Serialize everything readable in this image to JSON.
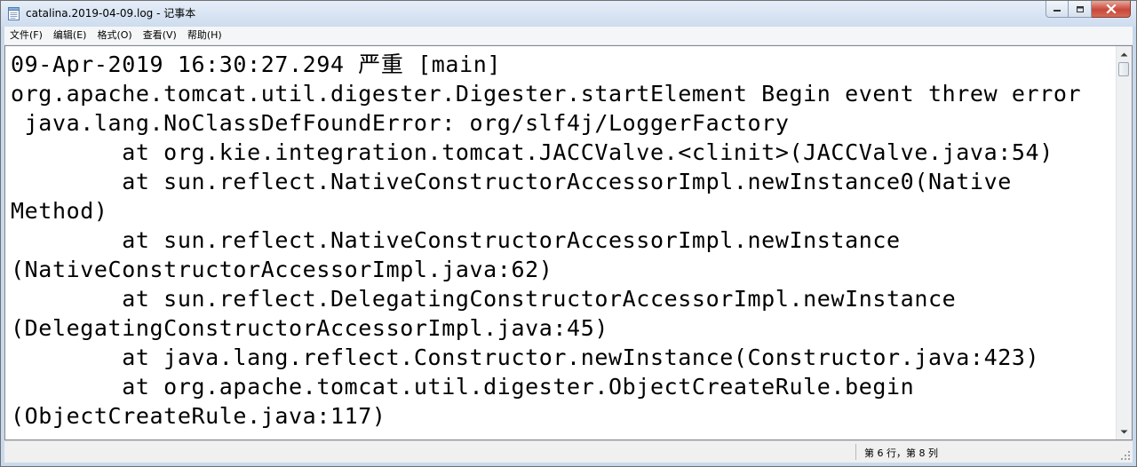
{
  "window": {
    "title": "catalina.2019-04-09.log - 记事本"
  },
  "menu": [
    {
      "label": "文件(F)"
    },
    {
      "label": "编辑(E)"
    },
    {
      "label": "格式(O)"
    },
    {
      "label": "查看(V)"
    },
    {
      "label": "帮助(H)"
    }
  ],
  "editor": {
    "lines": [
      "09-Apr-2019 16:30:27.294 严重 [main]",
      "org.apache.tomcat.util.digester.Digester.startElement Begin event threw error",
      " java.lang.NoClassDefFoundError: org/slf4j/LoggerFactory",
      "        at org.kie.integration.tomcat.JACCValve.<clinit>(JACCValve.java:54)",
      "        at sun.reflect.NativeConstructorAccessorImpl.newInstance0(Native",
      "Method)",
      "        at sun.reflect.NativeConstructorAccessorImpl.newInstance",
      "(NativeConstructorAccessorImpl.java:62)",
      "        at sun.reflect.DelegatingConstructorAccessorImpl.newInstance",
      "(DelegatingConstructorAccessorImpl.java:45)",
      "        at java.lang.reflect.Constructor.newInstance(Constructor.java:423)",
      "        at org.apache.tomcat.util.digester.ObjectCreateRule.begin",
      "(ObjectCreateRule.java:117)"
    ]
  },
  "statusbar": {
    "position": "第 6 行，第 8 列"
  },
  "icons": {
    "app": "notepad-icon",
    "minimize": "minimize-icon",
    "maximize": "maximize-icon",
    "close": "close-icon"
  },
  "colors": {
    "titlebar": "#cddcef",
    "close_button": "#c9473a",
    "editor_bg": "#ffffff"
  }
}
